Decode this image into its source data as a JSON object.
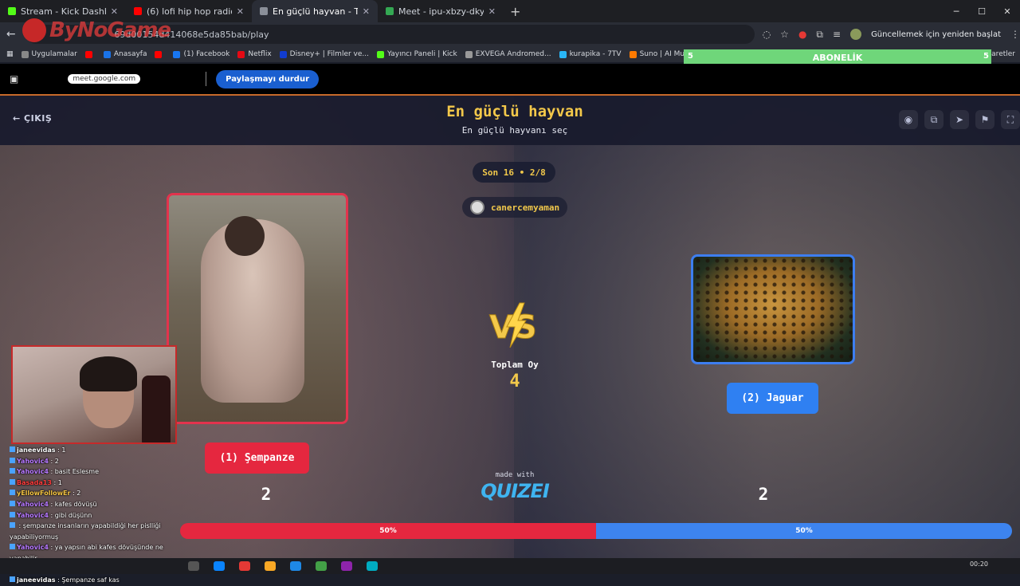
{
  "browser": {
    "tabs": [
      {
        "title": "Stream - Kick Dashboard",
        "color": "#53fc18",
        "active": false
      },
      {
        "title": "(6) lofi hip hop radio 📚 be",
        "color": "#ff0000",
        "active": false
      },
      {
        "title": "En güçlü hayvan - Tier List,",
        "color": "#8a8f99",
        "active": true
      },
      {
        "title": "Meet - ipu-xbzy-dky",
        "color": "#34a853",
        "active": false
      }
    ],
    "new_tab": "+",
    "url_tail": "69d00154d414068e5da85bab/play",
    "update_label": "Güncellemek için yeniden başlat",
    "bookmarks": [
      {
        "label": "Uygulamalar",
        "color": "#888"
      },
      {
        "label": "",
        "color": "#ff0000"
      },
      {
        "label": "Anasayfa",
        "color": "#1a73e8"
      },
      {
        "label": "",
        "color": "#ff0000"
      },
      {
        "label": "(1) Facebook",
        "color": "#1877f2"
      },
      {
        "label": "Netflix",
        "color": "#e50914"
      },
      {
        "label": "Disney+ | Filmler ve...",
        "color": "#113ccf"
      },
      {
        "label": "Yayıncı Paneli | Kick",
        "color": "#53fc18"
      },
      {
        "label": "EXVEGA Andromed...",
        "color": "#999"
      },
      {
        "label": "kurapika - 7TV",
        "color": "#29b6f6"
      },
      {
        "label": "Suno | AI Music",
        "color": "#ff7a00"
      },
      {
        "label": "(6) A Medieval",
        "color": "#ff0000"
      }
    ],
    "bookmarks_tail": "İşaretler",
    "overlay_logo": "ByNoGame"
  },
  "abonelik": {
    "label": "ABONELİK",
    "left": "5",
    "right": "5"
  },
  "share": {
    "meet_chip": "meet.google.com",
    "stop_label": "Paylaşmayı durdur"
  },
  "quiz": {
    "exit_label": "ÇIKIŞ",
    "title": "En güçlü hayvan",
    "subtitle": "En güçlü hayvanı seç",
    "round": "Son 16 • 2/8",
    "creator": "canercemyaman",
    "total_label": "Toplam Oy",
    "total_value": "4",
    "made_with": "made with",
    "brand": "QUIZEI",
    "left": {
      "label": "(1) Şempanze",
      "count": "2",
      "percent": 50,
      "percent_label": "50%",
      "color": "#e5273f"
    },
    "right": {
      "label": "(2) Jaguar",
      "count": "2",
      "percent": 50,
      "percent_label": "50%",
      "color": "#3d84ef"
    }
  },
  "chat": [
    {
      "user": "janeevidas",
      "text": " : 1",
      "color": "#ffffff"
    },
    {
      "user": "Yahovic4",
      "text": " : 2",
      "color": "#b678ff"
    },
    {
      "user": "Yahovic4",
      "text": " : basit Eslesme",
      "color": "#b678ff"
    },
    {
      "user": "Basada13",
      "text": " : 1",
      "color": "#ff3b3b"
    },
    {
      "user": "yEllowFollowEr",
      "text": " : 2",
      "color": "#f5c542"
    },
    {
      "user": "Yahovic4",
      "text": " : kafes dövüşü",
      "color": "#b678ff"
    },
    {
      "user": "Yahovic4",
      "text": " : gibi düşünn",
      "color": "#b678ff"
    },
    {
      "user": "",
      "text": " : şempanze insanların yapabildiği her pislliği yapabiliyormuş",
      "color": "#ff3b3b"
    },
    {
      "user": "Yahovic4",
      "text": " : ya yapsın abi kafes dövüşünde ne yapabilir",
      "color": "#b678ff"
    },
    {
      "user": "janeevidas",
      "text": " : 1",
      "color": "#ffffff"
    },
    {
      "user": "janeevidas",
      "text": " : Şempanze saf kas",
      "color": "#ffffff"
    }
  ],
  "taskbar": {
    "clock": "00:20"
  }
}
